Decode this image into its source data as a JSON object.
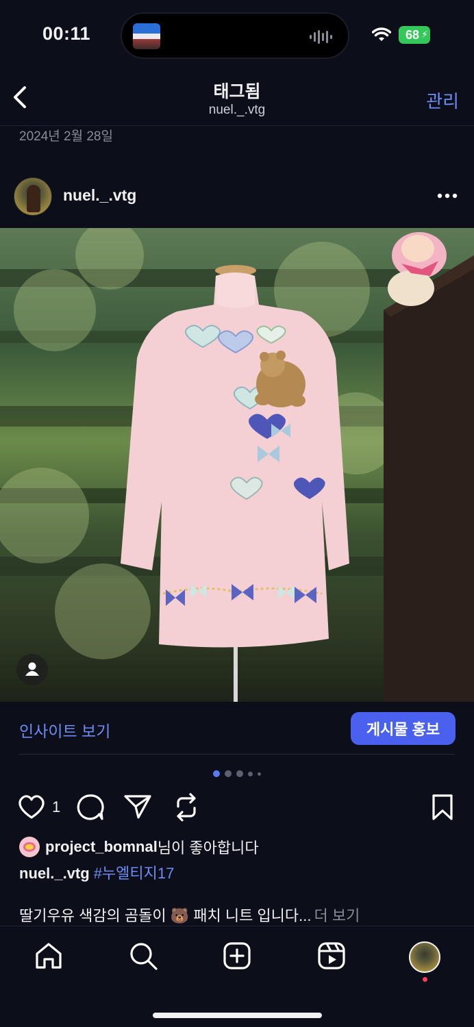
{
  "status_bar": {
    "time": "00:11",
    "battery": "68"
  },
  "header": {
    "title": "태그됨",
    "subtitle": "nuel._.vtg",
    "manage_label": "관리"
  },
  "post": {
    "date": "2024년 2월 28일",
    "author": "nuel._.vtg",
    "insight_label": "인사이트 보기",
    "promote_label": "게시물 홍보",
    "like_count": "1",
    "liked_by_user": "project_bomnal",
    "liked_by_suffix": "님이 좋아합니다",
    "caption_user": "nuel._.vtg",
    "caption_hashtag": "#누엘티지17",
    "caption_text": "딸기우유 색감의 곰돌이 🐻 패치 니트 입니다...",
    "more_label": "더 보기",
    "carousel_total": 5,
    "carousel_active": 0
  },
  "icons": {
    "back": "chevron-left-icon",
    "more": "more-horizontal-icon",
    "like": "heart-icon",
    "comment": "comment-icon",
    "share": "send-icon",
    "repost": "repost-icon",
    "save": "bookmark-icon",
    "home": "home-icon",
    "search": "search-icon",
    "create": "plus-square-icon",
    "reels": "reels-icon"
  },
  "colors": {
    "background": "#0c0e1a",
    "accent": "#6f8cf5",
    "promote_button": "#4a60ef",
    "battery": "#34c759",
    "notify": "#ff3b5c"
  }
}
